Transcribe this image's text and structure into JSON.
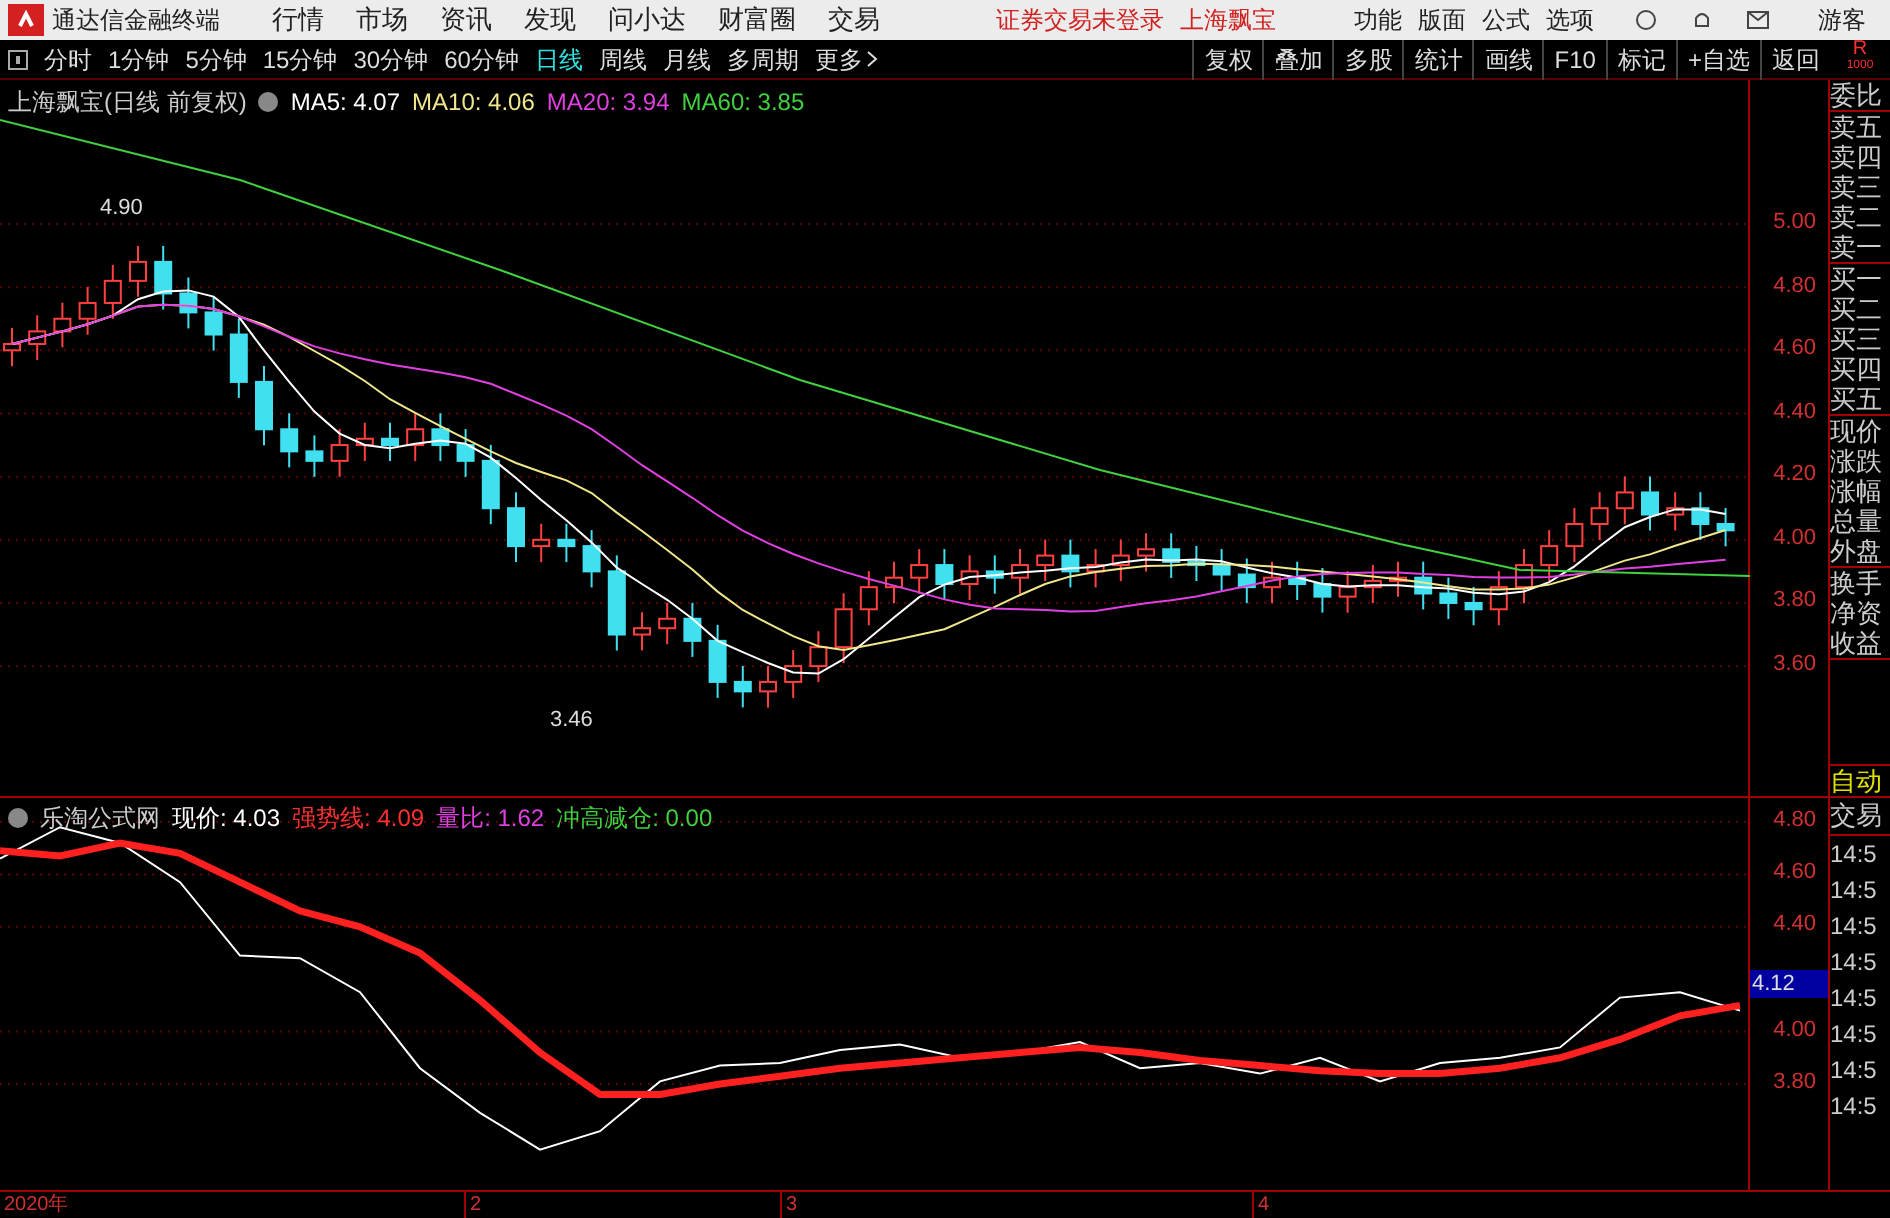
{
  "menu_bar": {
    "app_title": "通达信金融终端",
    "menus": [
      "行情",
      "市场",
      "资讯",
      "发现",
      "问小达",
      "财富圈",
      "交易"
    ],
    "login_status": "证券交易未登录",
    "stock": "上海飘宝",
    "tools": [
      "功能",
      "版面",
      "公式",
      "选项"
    ],
    "user": "游客"
  },
  "toolbar": {
    "periods": [
      {
        "label": "分时",
        "selected": false
      },
      {
        "label": "1分钟",
        "selected": false
      },
      {
        "label": "5分钟",
        "selected": false
      },
      {
        "label": "15分钟",
        "selected": false
      },
      {
        "label": "30分钟",
        "selected": false
      },
      {
        "label": "60分钟",
        "selected": false
      },
      {
        "label": "日线",
        "selected": true
      },
      {
        "label": "周线",
        "selected": false
      },
      {
        "label": "月线",
        "selected": false
      },
      {
        "label": "多周期",
        "selected": false
      }
    ],
    "more": "更多",
    "actions": [
      "复权",
      "叠加",
      "多股",
      "统计",
      "画线",
      "F10",
      "标记",
      "+自选",
      "返回"
    ]
  },
  "main_chart": {
    "legend": {
      "title": "上海飘宝(日线 前复权)",
      "items": [
        {
          "label": "MA5: 4.07",
          "color": "#ffffff"
        },
        {
          "label": "MA10: 4.06",
          "color": "#f0e68c"
        },
        {
          "label": "MA20: 3.94",
          "color": "#e040e0"
        },
        {
          "label": "MA60: 3.85",
          "color": "#40d040"
        }
      ]
    },
    "high_label": "4.90",
    "low_label": "3.46",
    "y_ticks": [
      "5.00",
      "4.80",
      "4.60",
      "4.40",
      "4.20",
      "4.00",
      "3.80",
      "3.60"
    ]
  },
  "indicator_chart": {
    "legend": {
      "title": "乐淘公式网",
      "items": [
        {
          "label": "现价: 4.03",
          "color": "#ffffff"
        },
        {
          "label": "强势线: 4.09",
          "color": "#ff3030"
        },
        {
          "label": "量比: 1.62",
          "color": "#e040e0"
        },
        {
          "label": "冲高减仓: 0.00",
          "color": "#40d040"
        }
      ]
    },
    "y_ticks": [
      "4.80",
      "4.60",
      "4.40",
      "4.00",
      "3.80"
    ],
    "current_value": "4.12"
  },
  "time_axis": [
    "2020年",
    "2",
    "3",
    "4"
  ],
  "quote_panel": {
    "header": "R",
    "header_sub": "1000",
    "groups": [
      {
        "items": [
          "委比"
        ]
      },
      {
        "items": [
          "卖五",
          "卖四",
          "卖三",
          "卖二",
          "卖一"
        ]
      },
      {
        "items": [
          "买一",
          "买二",
          "买三",
          "买四",
          "买五"
        ]
      },
      {
        "items": [
          "现价",
          "涨跌",
          "涨幅",
          "总量",
          "外盘"
        ]
      },
      {
        "items": [
          "换手",
          "净资",
          "收益"
        ]
      }
    ],
    "auto_label": "自动",
    "trade_label": "交易",
    "trade_times": [
      "14:5",
      "14:5",
      "14:5",
      "14:5",
      "14:5",
      "14:5",
      "14:5",
      "14:5"
    ]
  }
}
